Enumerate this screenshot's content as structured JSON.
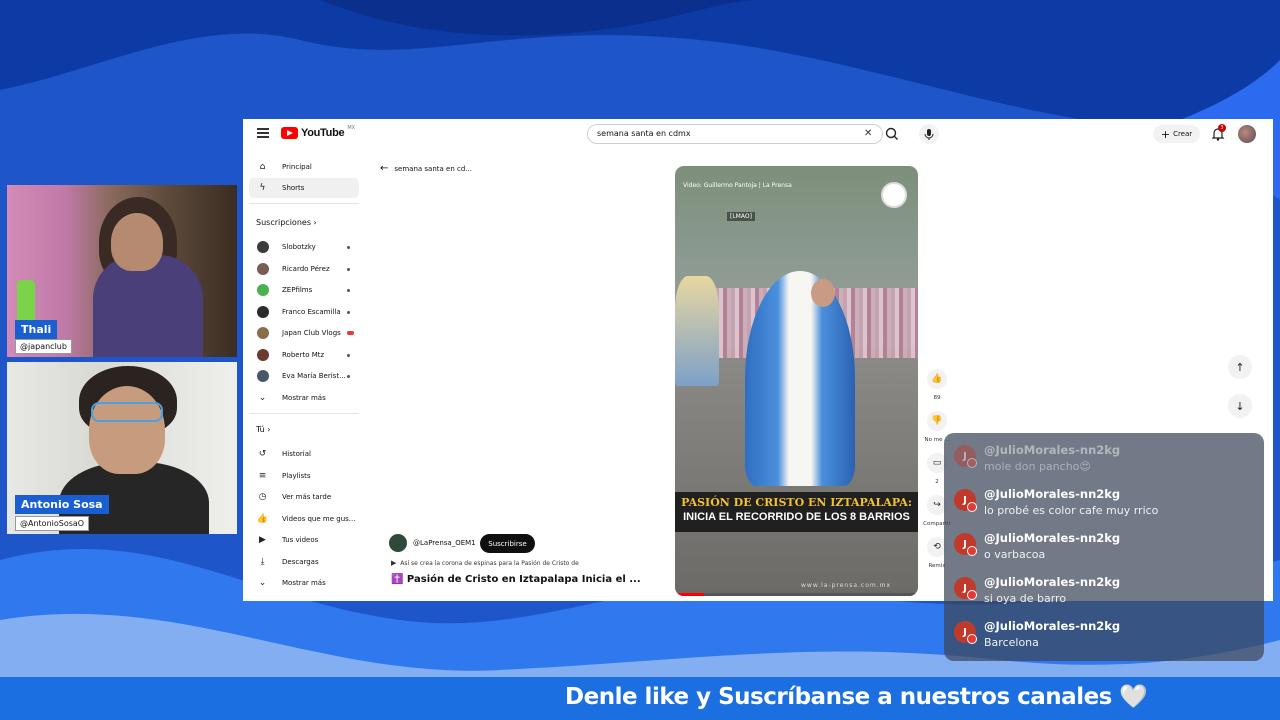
{
  "webcams": [
    {
      "name": "Thali",
      "handle": "@japanclub"
    },
    {
      "name": "Antonio Sosa",
      "handle": "@AntonioSosaO"
    }
  ],
  "youtube": {
    "logo_text": "YouTube",
    "country": "MX",
    "search_value": "semana santa en cdmx",
    "create_label": "Crear",
    "notifications_count": "3",
    "sidebar": {
      "main": [
        {
          "label": "Principal",
          "icon": "home-icon"
        },
        {
          "label": "Shorts",
          "icon": "shorts-icon",
          "active": true
        }
      ],
      "subscriptions_heading": "Suscripciones",
      "subscriptions": [
        {
          "label": "Slobotzky",
          "color": "#3b3b3b"
        },
        {
          "label": "Ricardo Pérez",
          "color": "#7a5c55"
        },
        {
          "label": "ZEPfilms",
          "color": "#4caf50"
        },
        {
          "label": "Franco Escamilla",
          "color": "#2b2b2b"
        },
        {
          "label": "Japan Club Vlogs",
          "color": "#8a6d4d"
        },
        {
          "label": "Roberto Mtz",
          "color": "#6b3b2b"
        },
        {
          "label": "Eva María Berist...",
          "color": "#455a64"
        }
      ],
      "show_more_subs": "Mostrar más",
      "you_heading": "Tú",
      "you_items": [
        {
          "label": "Historial",
          "icon": "history-icon"
        },
        {
          "label": "Playlists",
          "icon": "playlist-icon"
        },
        {
          "label": "Ver más tarde",
          "icon": "clock-icon"
        },
        {
          "label": "Videos que me gus...",
          "icon": "thumbs-up-icon"
        },
        {
          "label": "Tus videos",
          "icon": "video-icon"
        },
        {
          "label": "Descargas",
          "icon": "download-icon"
        }
      ],
      "show_more_you": "Mostrar más"
    },
    "back_label": "semana santa en cd...",
    "short": {
      "credit": "Video: Guillermo Pantoja | La Prensa",
      "small_tag": "[LMAO]",
      "banner_line1": "PASIÓN DE CRISTO EN IZTAPALAPA:",
      "banner_line2": "INICIA EL RECORRIDO DE LOS 8 BARRIOS",
      "watermark": "www.la-prensa.com.mx",
      "progress": 0.12
    },
    "channel": "@LaPrensa_OEM1",
    "subscribe_label": "Suscribirse",
    "description": "Así se crea la corona de espinas para la Pasión de Cristo de",
    "title": "✝️ Pasión de Cristo en Iztapalapa Inicia el ...",
    "actions": {
      "likes": "89",
      "dislike_label": "No me ...",
      "comments": "2",
      "share_label": "Compartir",
      "remix_label": "Remix"
    }
  },
  "chat": [
    {
      "user": "@JulioMorales-nn2kg",
      "text": "mole don pancho😍",
      "avatar": "J",
      "faded": true
    },
    {
      "user": "@JulioMorales-nn2kg",
      "text": "lo probé es color cafe muy rrico",
      "avatar": "J"
    },
    {
      "user": "@JulioMorales-nn2kg",
      "text": "o varbacoa",
      "avatar": "J"
    },
    {
      "user": "@JulioMorales-nn2kg",
      "text": "si oya de barro",
      "avatar": "J"
    },
    {
      "user": "@JulioMorales-nn2kg",
      "text": "Barcelona",
      "avatar": "J"
    }
  ],
  "footer_text": "Denle like y Suscríbanse a nuestros canales 🤍"
}
